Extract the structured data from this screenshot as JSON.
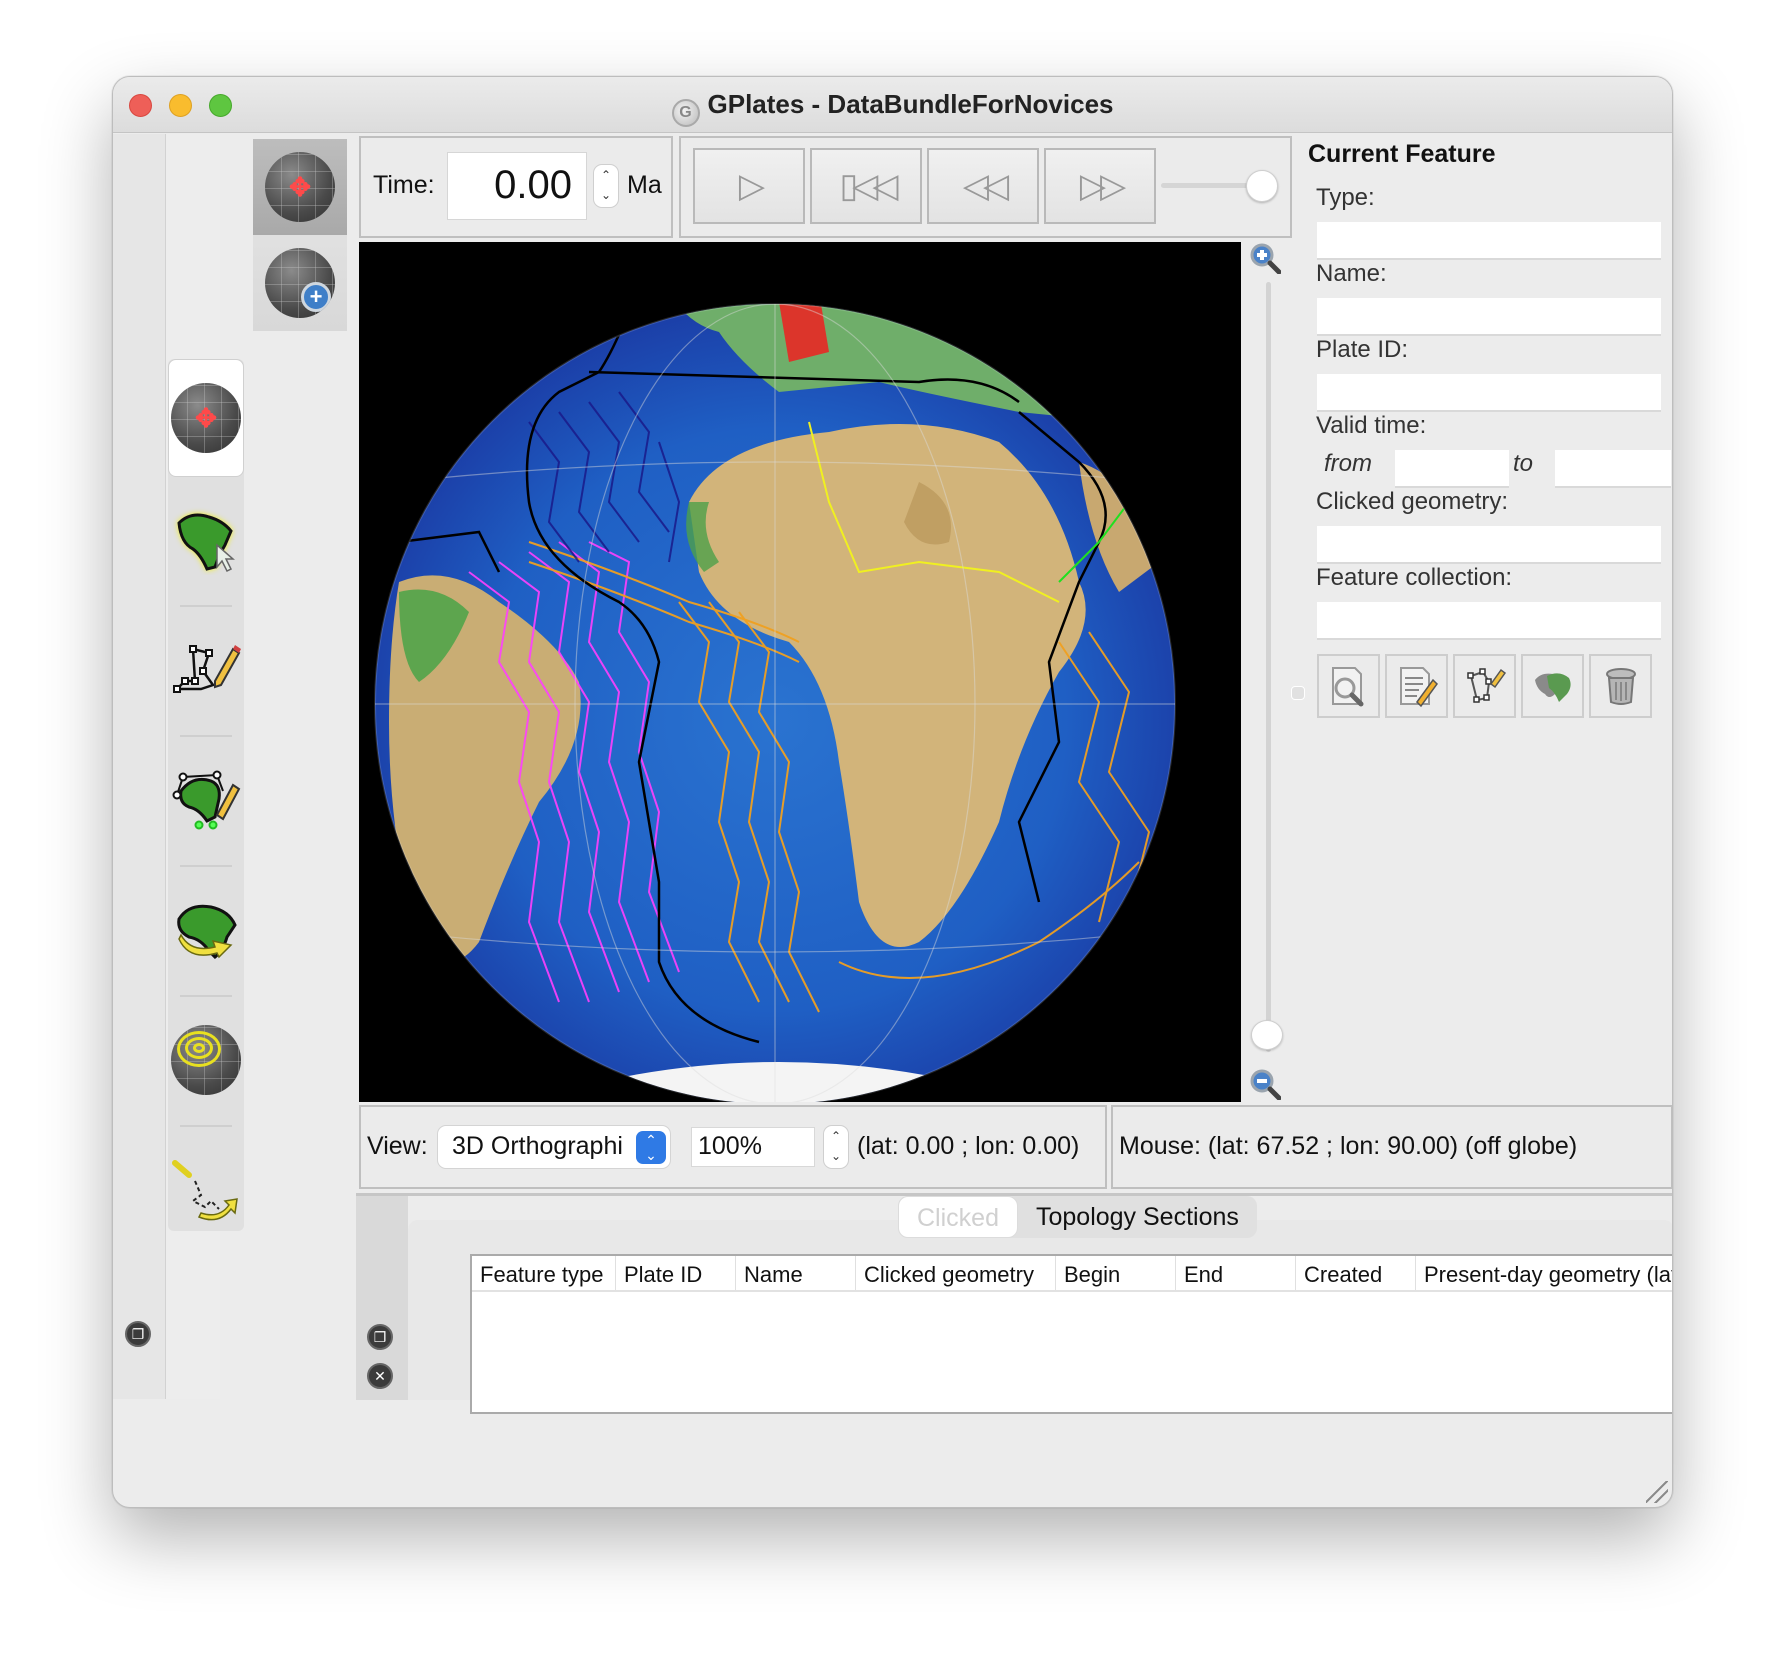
{
  "window": {
    "title": "GPlates - DataBundleForNovices",
    "app_icon": "gplates-logo-icon",
    "traffic_lights": [
      "close",
      "minimize",
      "maximize"
    ]
  },
  "view_tools": [
    {
      "name": "drag-globe",
      "icon": "globe-drag-icon",
      "active": true
    },
    {
      "name": "zoom-globe",
      "icon": "globe-zoom-icon",
      "active": false
    }
  ],
  "toolbox": [
    {
      "name": "drag-globe",
      "icon": "globe-drag-icon",
      "selected": true
    },
    {
      "name": "choose-feature",
      "icon": "choose-feature-icon",
      "selected": false
    },
    {
      "name": "digitise-geometry",
      "icon": "digitise-geometry-icon",
      "selected": false
    },
    {
      "name": "edit-topology",
      "icon": "edit-topology-icon",
      "selected": false
    },
    {
      "name": "move-feature",
      "icon": "move-feature-icon",
      "selected": false
    },
    {
      "name": "small-circle",
      "icon": "small-circle-icon",
      "selected": false
    },
    {
      "name": "pole-manipulation",
      "icon": "pole-manipulation-icon",
      "selected": false
    }
  ],
  "time": {
    "label": "Time:",
    "value": "0.00",
    "unit": "Ma"
  },
  "animation": {
    "buttons": [
      {
        "name": "play",
        "icon": "play-icon",
        "glyph": "▷"
      },
      {
        "name": "reset",
        "icon": "rewind-to-start-icon",
        "glyph": "▯◁◁"
      },
      {
        "name": "step-back",
        "icon": "step-back-icon",
        "glyph": "◁◁"
      },
      {
        "name": "step-forward",
        "icon": "step-forward-icon",
        "glyph": "▷▷"
      }
    ],
    "slider_position": 1.0
  },
  "globe_zoom": {
    "zoom_in_icon": "zoom-in-icon",
    "zoom_out_icon": "zoom-out-icon",
    "slider_position": 0.0
  },
  "current_feature": {
    "title": "Current Feature",
    "type_label": "Type:",
    "type_value": "",
    "name_label": "Name:",
    "name_value": "",
    "plate_id_label": "Plate ID:",
    "plate_id_value": "",
    "valid_time_label": "Valid time:",
    "from_label": "from",
    "from_value": "",
    "to_label": "to",
    "to_value": "",
    "clicked_geometry_label": "Clicked geometry:",
    "clicked_geometry_value": "",
    "feature_collection_label": "Feature collection:",
    "feature_collection_value": "",
    "actions": [
      {
        "name": "query-feature",
        "icon": "query-feature-icon"
      },
      {
        "name": "edit-feature",
        "icon": "edit-feature-icon"
      },
      {
        "name": "edit-geometry",
        "icon": "edit-geometry-icon"
      },
      {
        "name": "clone-feature",
        "icon": "clone-feature-icon"
      },
      {
        "name": "delete-feature",
        "icon": "trash-icon"
      }
    ]
  },
  "view_bar": {
    "view_label": "View:",
    "projection": "3D Orthographi",
    "zoom": "100%",
    "camera": "(lat: 0.00 ; lon: 0.00)",
    "mouse": "Mouse: (lat: 67.52 ; lon: 90.00) (off globe)"
  },
  "bottom_panel": {
    "tabs": [
      {
        "label": "Clicked",
        "active": true
      },
      {
        "label": "Topology Sections",
        "active": false
      }
    ],
    "columns": [
      "Feature type",
      "Plate ID",
      "Name",
      "Clicked geometry",
      "Begin",
      "End",
      "Created",
      "Present-day geometry (lat ; l"
    ],
    "rows": []
  },
  "colors": {
    "window_bg": "#ececec",
    "canvas_bg": "#000000",
    "select_accent": "#2f7ae5",
    "close": "#ee5f58",
    "minimize": "#f9bc2e",
    "maximize": "#5ec640"
  }
}
